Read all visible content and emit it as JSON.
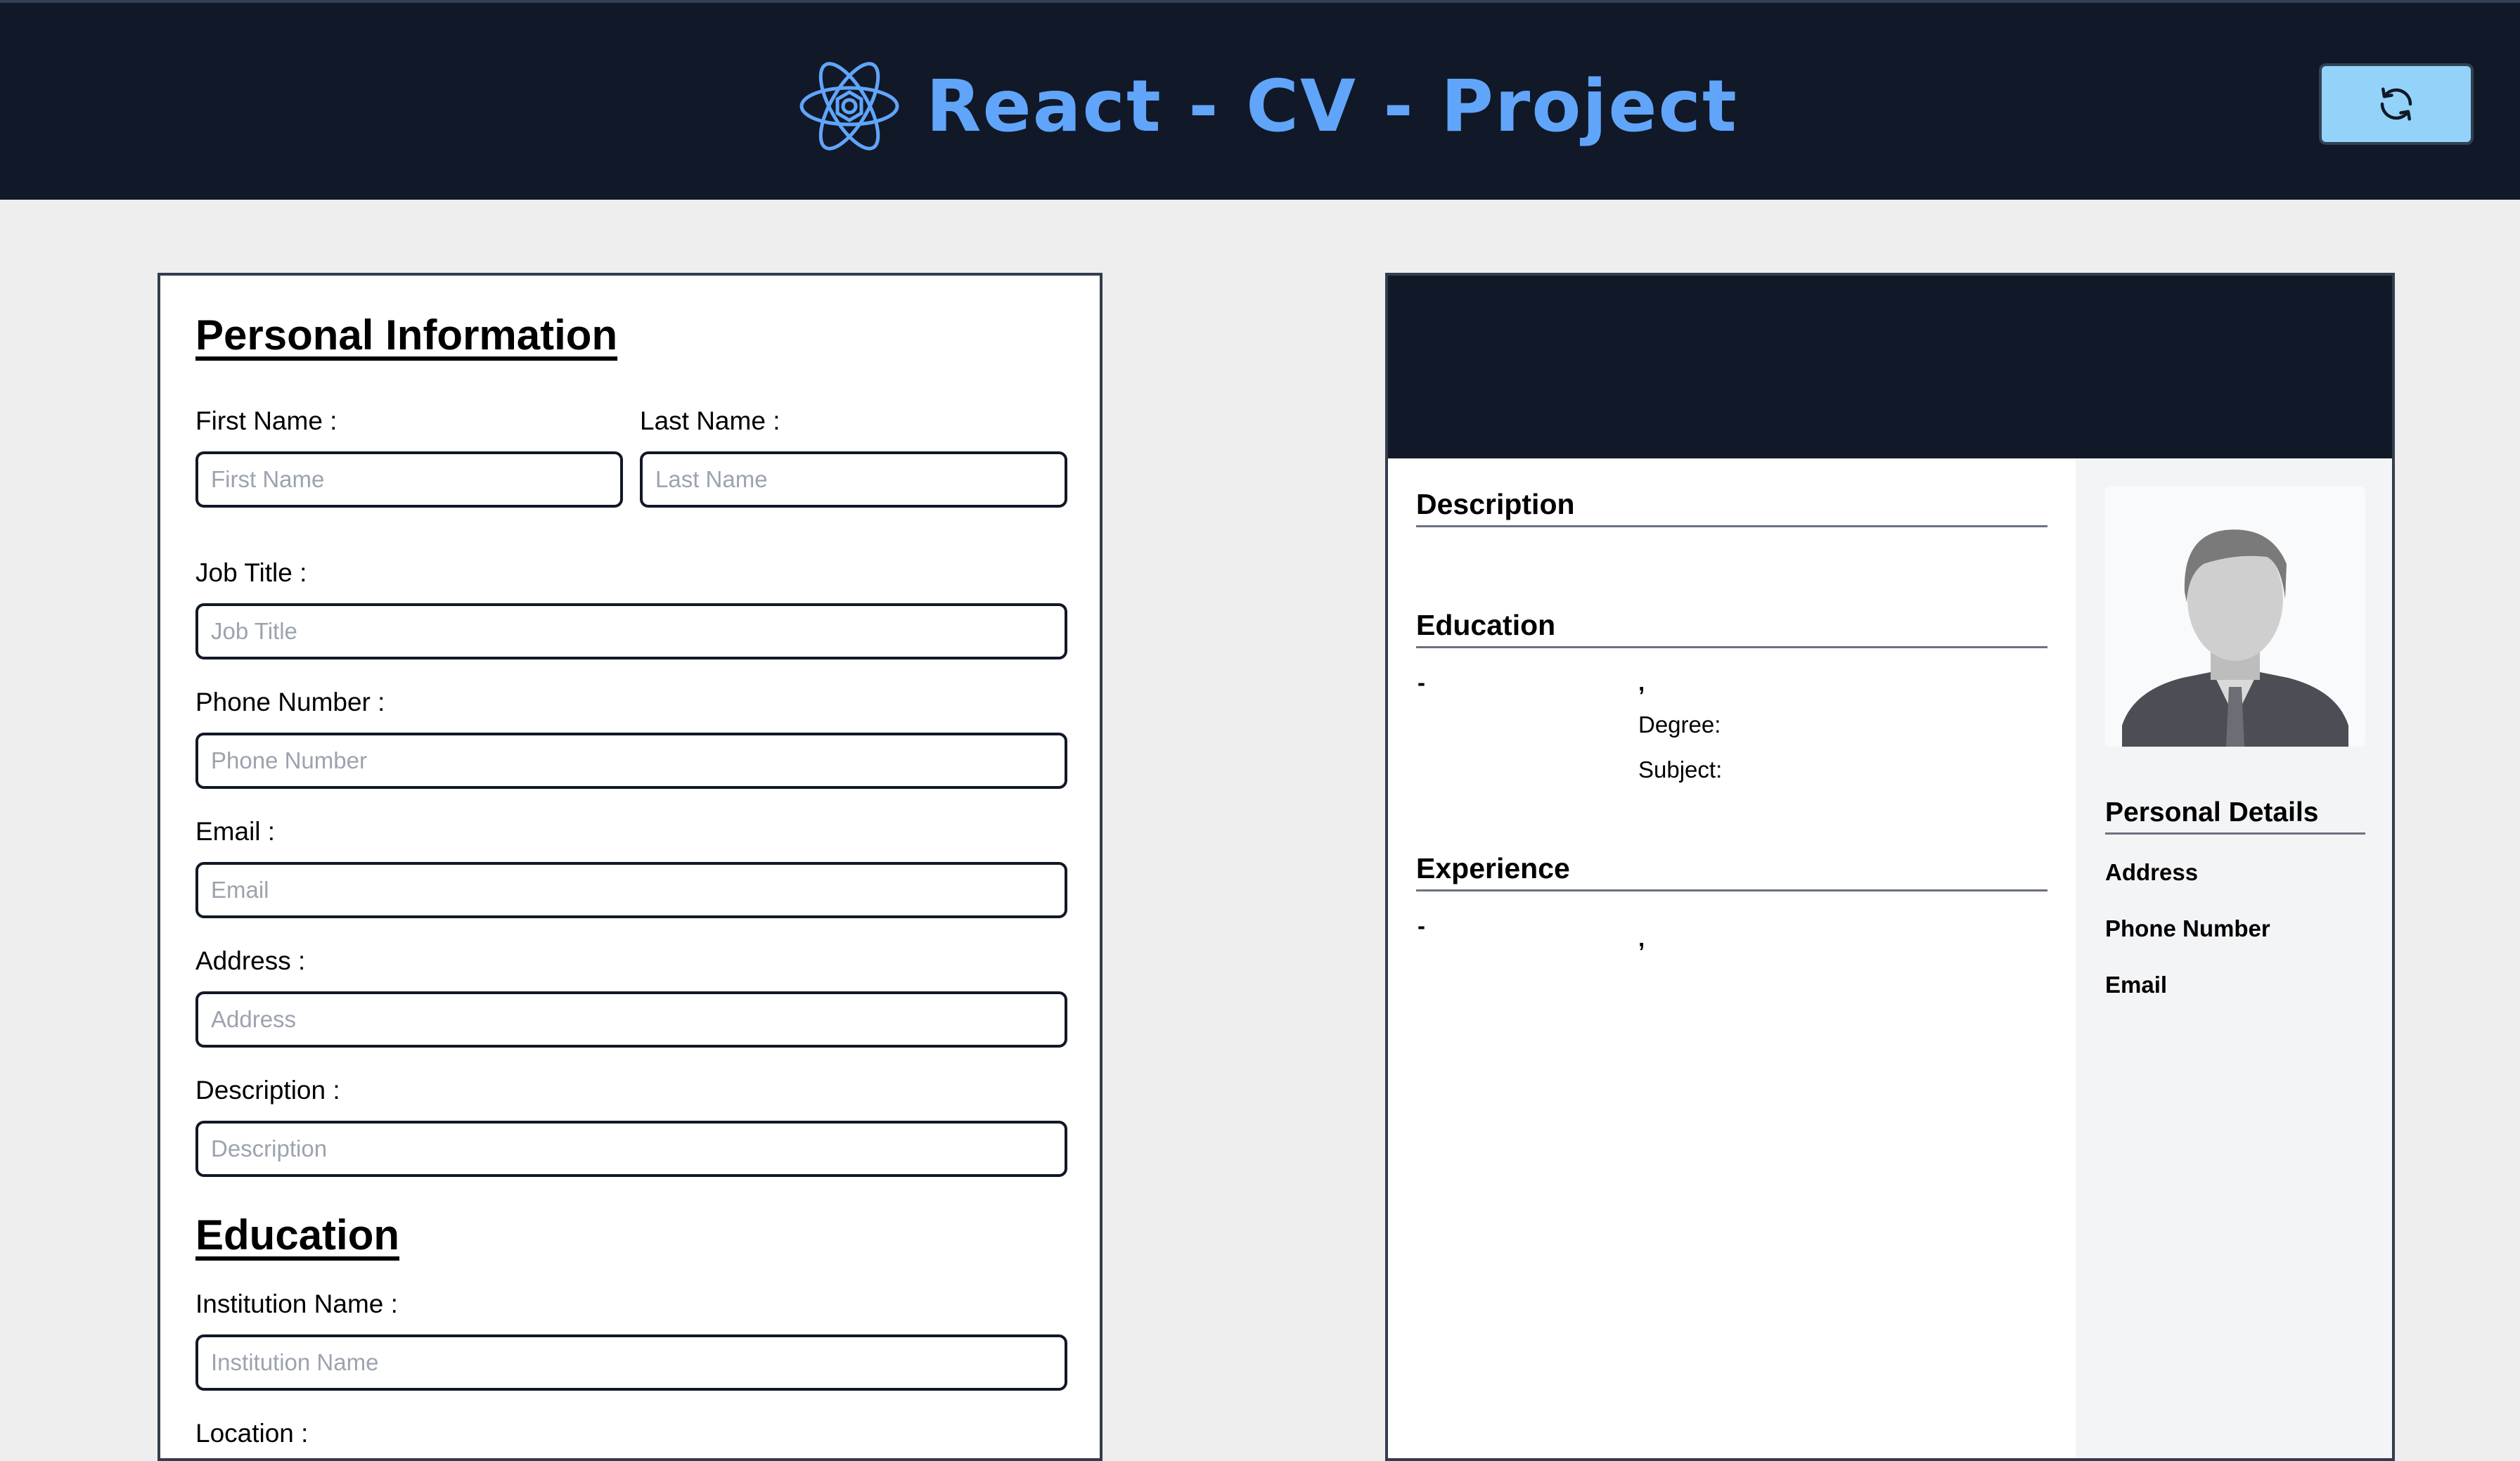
{
  "app": {
    "title": "React - CV - Project",
    "logo_icon": "react-atom-icon",
    "refresh_icon": "refresh-icon",
    "colors": {
      "header_bg": "#111827",
      "accent": "#60a5fa",
      "button_bg": "#93d3fa",
      "page_bg": "#eeeeee"
    }
  },
  "form": {
    "personal": {
      "heading": "Personal Information",
      "first_name": {
        "label": "First Name :",
        "placeholder": "First Name",
        "value": ""
      },
      "last_name": {
        "label": "Last Name :",
        "placeholder": "Last Name",
        "value": ""
      },
      "job_title": {
        "label": "Job Title :",
        "placeholder": "Job Title",
        "value": ""
      },
      "phone": {
        "label": "Phone Number :",
        "placeholder": "Phone Number",
        "value": ""
      },
      "email": {
        "label": "Email :",
        "placeholder": "Email",
        "value": ""
      },
      "address": {
        "label": "Address :",
        "placeholder": "Address",
        "value": ""
      },
      "description": {
        "label": "Description :",
        "placeholder": "Description",
        "value": ""
      }
    },
    "education": {
      "heading": "Education",
      "institution": {
        "label": "Institution Name :",
        "placeholder": "Institution Name",
        "value": ""
      },
      "location": {
        "label": "Location :"
      }
    }
  },
  "preview": {
    "description_heading": "Description",
    "education_heading": "Education",
    "education_entry": {
      "dash": "-",
      "comma": ",",
      "degree_label": "Degree:",
      "subject_label": "Subject:"
    },
    "experience_heading": "Experience",
    "experience_entry": {
      "dash": "-",
      "comma": ","
    },
    "avatar_icon": "avatar-placeholder-icon",
    "personal_details": {
      "heading": "Personal Details",
      "address_label": "Address",
      "phone_label": "Phone Number",
      "email_label": "Email"
    }
  }
}
